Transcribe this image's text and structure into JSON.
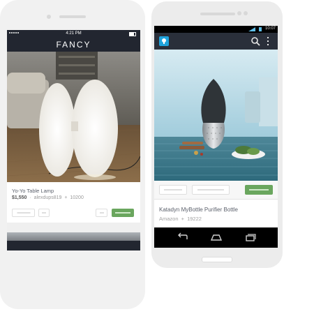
{
  "ios_app": {
    "status_time": "4:21 PM",
    "brand": "FANCY",
    "item": {
      "title": "Yo-Yo Table Lamp",
      "price": "$1,550",
      "separator": "·",
      "user": "alexdups819",
      "plus": "+",
      "count": "10200"
    }
  },
  "android_app": {
    "status_time": "10:07",
    "item": {
      "title": "Katadyn MyBottle Purifier Bottle",
      "source": "Amazon",
      "plus": "+",
      "count": "19222"
    }
  },
  "colors": {
    "accent_green": "#6aa65e",
    "accent_blue": "#1fa3dc",
    "header_dark": "#222630"
  },
  "icons": [
    "search-icon",
    "overflow-menu-icon",
    "back-icon",
    "home-icon",
    "recent-apps-icon"
  ]
}
